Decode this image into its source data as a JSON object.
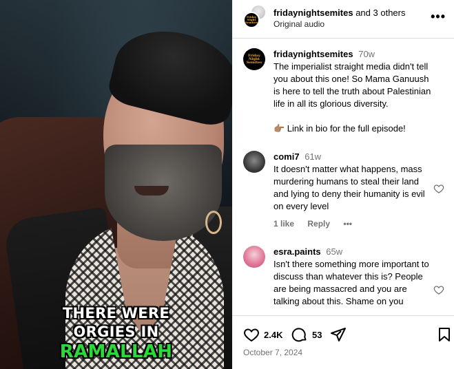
{
  "video": {
    "caption_line1": "THERE WERE",
    "caption_line2": "ORGIES IN",
    "caption_line3": "RAMALLAH",
    "caption_accent_color": "#2bd93a"
  },
  "header": {
    "avatar_text": "Friday Night Semites",
    "username": "fridaynightsemites",
    "others": " and 3 others",
    "subtitle": "Original audio",
    "more_icon": "more-horizontal-icon"
  },
  "caption_post": {
    "avatar_text": "Friday Night Semites",
    "username": "fridaynightsemites",
    "time": "70w",
    "text": "The imperialist straight media didn't tell you about this one! So Mama Ganuush is here to tell the truth about Palestinian life in all its glorious diversity.",
    "link_line": "👉🏽 Link in bio for the full episode!"
  },
  "comments": [
    {
      "username": "comi7",
      "time": "61w",
      "text": "It doesn't matter what happens, mass murdering humans to steal their land and lying to deny their humanity is evil on every level",
      "likes": "1 like",
      "reply": "Reply",
      "more": "•••"
    },
    {
      "username": "esra.paints",
      "time": "65w",
      "text": "Isn't there something more important to discuss than whatever this is? People are being massacred and you are talking about this. Shame on you"
    }
  ],
  "actions": {
    "likes": "2.4K",
    "comments": "53",
    "date": "October 7, 2024"
  },
  "colors": {
    "secondary_text": "#737373",
    "divider": "#dbdbdb"
  }
}
